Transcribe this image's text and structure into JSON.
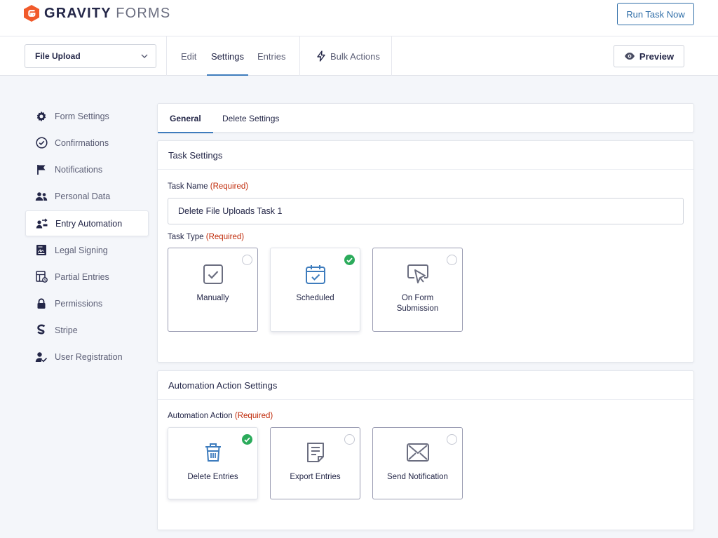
{
  "brand": {
    "name_bold": "GRAVITY",
    "name_light": "FORMS",
    "logo_color": "#f15a2b"
  },
  "header": {
    "run_task_label": "Run Task Now"
  },
  "toolbar": {
    "form_select_value": "File Upload",
    "tabs": [
      {
        "label": "Edit"
      },
      {
        "label": "Settings",
        "active": true
      },
      {
        "label": "Entries"
      }
    ],
    "bulk_actions_label": "Bulk Actions",
    "preview_label": "Preview"
  },
  "sidebar": {
    "items": [
      {
        "label": "Form Settings",
        "icon": "gear-icon"
      },
      {
        "label": "Confirmations",
        "icon": "check-circle-icon"
      },
      {
        "label": "Notifications",
        "icon": "flag-icon"
      },
      {
        "label": "Personal Data",
        "icon": "people-icon"
      },
      {
        "label": "Entry Automation",
        "icon": "automation-icon",
        "active": true
      },
      {
        "label": "Legal Signing",
        "icon": "signing-icon"
      },
      {
        "label": "Partial Entries",
        "icon": "partial-entries-icon"
      },
      {
        "label": "Permissions",
        "icon": "lock-icon"
      },
      {
        "label": "Stripe",
        "icon": "stripe-icon"
      },
      {
        "label": "User Registration",
        "icon": "user-check-icon"
      }
    ]
  },
  "subtabs": [
    {
      "label": "General",
      "active": true
    },
    {
      "label": "Delete Settings"
    }
  ],
  "task_settings": {
    "title": "Task Settings",
    "task_name_label": "Task Name",
    "required_label": "(Required)",
    "task_name_value": "Delete File Uploads Task 1",
    "task_type_label": "Task Type",
    "task_types": [
      {
        "label": "Manually",
        "icon": "checkbox-icon",
        "selected": false
      },
      {
        "label": "Scheduled",
        "icon": "calendar-icon",
        "selected": true
      },
      {
        "label": "On Form Submission",
        "icon": "cursor-click-icon",
        "selected": false
      }
    ]
  },
  "automation_settings": {
    "title": "Automation Action Settings",
    "action_label": "Automation Action",
    "required_label": "(Required)",
    "actions": [
      {
        "label": "Delete Entries",
        "icon": "trash-icon",
        "selected": true
      },
      {
        "label": "Export Entries",
        "icon": "document-icon",
        "selected": false
      },
      {
        "label": "Send Notification",
        "icon": "envelope-icon",
        "selected": false
      }
    ]
  },
  "colors": {
    "accent": "#3e7cbd",
    "required": "#c02b0a",
    "success": "#2bab5b",
    "text": "#242748"
  }
}
